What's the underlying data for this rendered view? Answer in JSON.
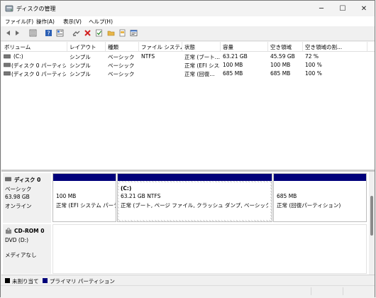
{
  "window": {
    "title": "ディスクの管理"
  },
  "menu": [
    "ファイル(F)",
    "操作(A)",
    "表示(V)",
    "ヘルプ(H)"
  ],
  "toolbar_icons": [
    "back-icon",
    "forward-icon",
    "list-view-icon",
    "help-icon",
    "properties-icon",
    "connect-icon",
    "delete-icon",
    "check-icon",
    "folder-icon",
    "open-icon",
    "settings-icon"
  ],
  "volume_list": {
    "columns": [
      "ボリューム",
      "レイアウト",
      "種類",
      "ファイル システム",
      "状態",
      "容量",
      "空き領域",
      "空き領域の割..."
    ],
    "rows": [
      [
        "(C:)",
        "シンプル",
        "ベーシック",
        "NTFS",
        "正常 (ブート...",
        "63.21 GB",
        "45.59 GB",
        "72 %"
      ],
      [
        "(ディスク 0 パーティショ...",
        "シンプル",
        "ベーシック",
        "",
        "正常 (EFI シス...",
        "100 MB",
        "100 MB",
        "100 %"
      ],
      [
        "(ディスク 0 パーティショ...",
        "シンプル",
        "ベーシック",
        "",
        "正常 (回復...",
        "685 MB",
        "685 MB",
        "100 %"
      ]
    ]
  },
  "disks": [
    {
      "name": "ディスク 0",
      "type": "ベーシック",
      "size": "63.98 GB",
      "status": "オンライン",
      "partitions": [
        {
          "title": "",
          "size": "100 MB",
          "status": "正常 (EFI システム パーテ..."
        },
        {
          "title": "(C:)",
          "size": "63.21 GB NTFS",
          "status": "正常 (ブート, ページ ファイル, クラッシュ ダンプ, ベーシック データ パー..."
        },
        {
          "title": "",
          "size": "685 MB",
          "status": "正常 (回復パーティション)"
        }
      ]
    },
    {
      "name": "CD-ROM 0",
      "type": "DVD (D:)",
      "status": "メディアなし"
    }
  ],
  "legend": [
    {
      "label": "未割り当て",
      "color": "#000000"
    },
    {
      "label": "プライマリ パーティション",
      "color": "#00007a"
    }
  ],
  "colors": {
    "primary_partition": "#00007a",
    "unallocated": "#000000"
  }
}
